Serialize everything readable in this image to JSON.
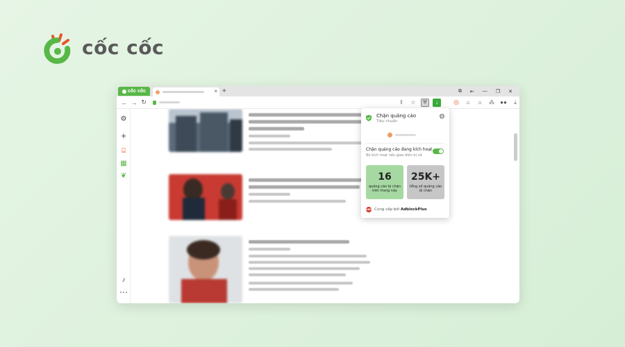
{
  "brand": {
    "name": "cốc cốc"
  },
  "browser": {
    "brand_tab_label": "cốc cốc",
    "tab_close": "×",
    "new_tab": "+",
    "window_controls": [
      "⧉",
      "⇤",
      "—",
      "❐",
      "✕"
    ],
    "nav": {
      "back": "←",
      "forward": "→",
      "reload": "↻"
    }
  },
  "popup": {
    "title": "Chặn quảng cáo",
    "subtitle": "Tiêu chuẩn",
    "toggle_label": "Chặn quảng cáo đang kích hoạt",
    "toggle_sublabel": "Bỏ kích hoạt nếu giao diện bị vỡ",
    "toggle_on": true,
    "stats": [
      {
        "value": "16",
        "label": "quảng cáo bị chặn trên trang này"
      },
      {
        "value": "25K+",
        "label": "tổng số quảng cáo bị chặn"
      }
    ],
    "footer_prefix": "Cung cấp bởi",
    "footer_brand": "AdblockPlus",
    "abp_badge": "ABP"
  },
  "colors": {
    "accent": "#57b847",
    "background": "#e0f2df",
    "stat_green": "#a6d9a1",
    "stat_grey": "#c6c6c6"
  }
}
